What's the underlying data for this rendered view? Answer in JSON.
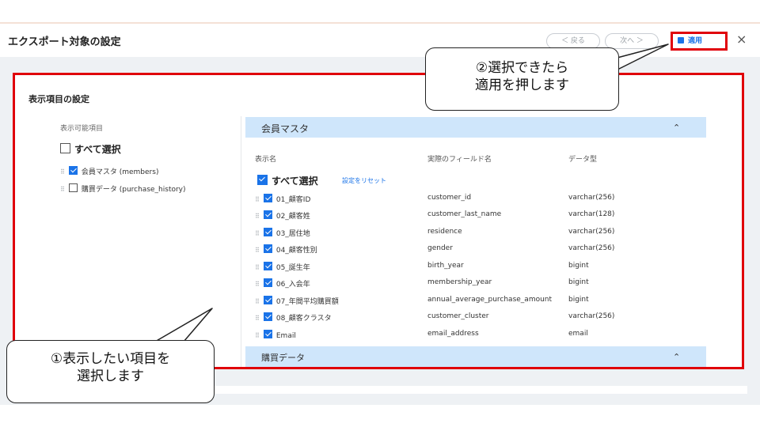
{
  "dialog": {
    "title": "エクスポート対象の設定",
    "back_label": "＜ 戻る",
    "next_label": "次へ ＞",
    "apply_label": "適用",
    "close_label": "×"
  },
  "settings": {
    "section_title": "表示項目の設定",
    "left": {
      "header": "表示可能項目",
      "select_all": "すべて選択",
      "items": [
        {
          "label": "会員マスタ (members)",
          "checked": true
        },
        {
          "label": "購買データ (purchase_history)",
          "checked": false
        }
      ]
    },
    "right": {
      "group1": "会員マスタ",
      "group2": "購買データ",
      "columns": {
        "display_name": "表示名",
        "field_name": "実際のフィールド名",
        "data_type": "データ型"
      },
      "select_all": "すべて選択",
      "reset": "設定をリセット",
      "rows": [
        {
          "name": "01_顧客ID",
          "field": "customer_id",
          "type": "varchar(256)"
        },
        {
          "name": "02_顧客姓",
          "field": "customer_last_name",
          "type": "varchar(128)"
        },
        {
          "name": "03_居住地",
          "field": "residence",
          "type": "varchar(256)"
        },
        {
          "name": "04_顧客性別",
          "field": "gender",
          "type": "varchar(256)"
        },
        {
          "name": "05_誕生年",
          "field": "birth_year",
          "type": "bigint"
        },
        {
          "name": "06_入会年",
          "field": "membership_year",
          "type": "bigint"
        },
        {
          "name": "07_年間平均購買額",
          "field": "annual_average_purchase_amount",
          "type": "bigint"
        },
        {
          "name": "08_顧客クラスタ",
          "field": "customer_cluster",
          "type": "varchar(256)"
        },
        {
          "name": "Email",
          "field": "email_address",
          "type": "email"
        }
      ]
    }
  },
  "callouts": {
    "apply_line1": "②選択できたら",
    "apply_line2": "適用を押します",
    "select_line1": "①表示したい項目を",
    "select_line2": "選択します"
  },
  "colors": {
    "accent": "#1a73e8",
    "highlight": "#e0000a",
    "group_bar": "#cfe6fb"
  }
}
